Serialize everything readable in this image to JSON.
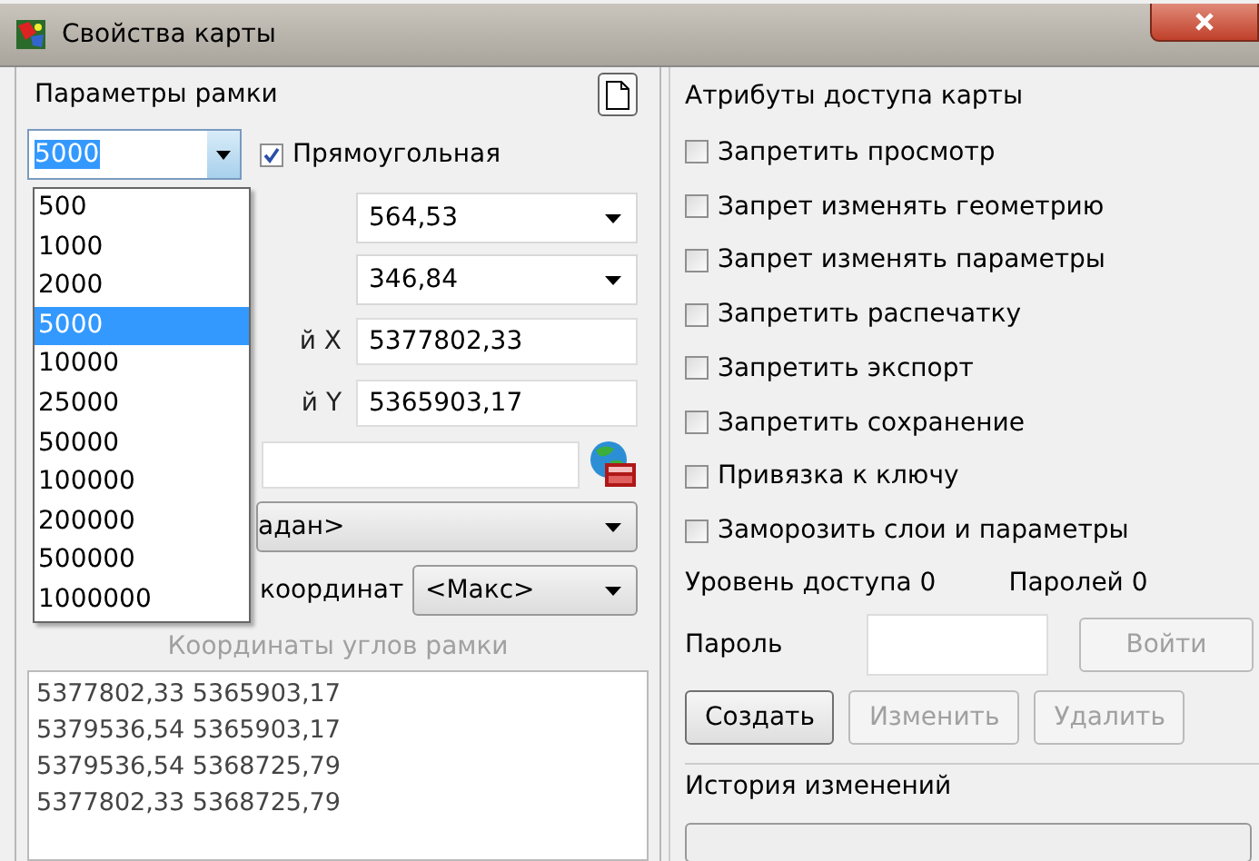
{
  "window": {
    "title": "Свойства карты"
  },
  "frame": {
    "title": "Параметры рамки",
    "scale": {
      "value": "5000",
      "open": true,
      "options": [
        {
          "label": "500",
          "selected": false
        },
        {
          "label": "1000",
          "selected": false
        },
        {
          "label": "2000",
          "selected": false
        },
        {
          "label": "5000",
          "selected": true
        },
        {
          "label": "10000",
          "selected": false
        },
        {
          "label": "25000",
          "selected": false
        },
        {
          "label": "50000",
          "selected": false
        },
        {
          "label": "100000",
          "selected": false
        },
        {
          "label": "200000",
          "selected": false
        },
        {
          "label": "500000",
          "selected": false
        },
        {
          "label": "1000000",
          "selected": false
        }
      ]
    },
    "rectangular": {
      "label": "Прямоугольная",
      "checked": true
    },
    "rows": [
      {
        "kind": "combo",
        "value": "564,53"
      },
      {
        "kind": "combo",
        "value": "346,84"
      },
      {
        "kind": "text",
        "label": "й X",
        "value": "5377802,33"
      },
      {
        "kind": "text",
        "label": "й Y",
        "value": "5365903,17"
      },
      {
        "kind": "picker"
      },
      {
        "kind": "wide-combo",
        "value": "адан>"
      }
    ],
    "precision": {
      "label": "координат",
      "value": "<Макс>"
    },
    "corners_title": "Координаты углов рамки",
    "corners": [
      "5377802,33 5365903,17",
      "5379536,54 5365903,17",
      "5379536,54 5368725,79",
      "5377802,33 5368725,79"
    ]
  },
  "access": {
    "title": "Атрибуты доступа карты",
    "options": [
      {
        "label": "Запретить просмотр",
        "checked": false
      },
      {
        "label": "Запрет изменять геометрию",
        "checked": false
      },
      {
        "label": "Запрет изменять параметры",
        "checked": false
      },
      {
        "label": "Запретить распечатку",
        "checked": false
      },
      {
        "label": "Запретить экспорт",
        "checked": false
      },
      {
        "label": "Запретить сохранение",
        "checked": false
      },
      {
        "label": "Привязка к ключу",
        "checked": false
      },
      {
        "label": "Заморозить слои и параметры",
        "checked": false
      }
    ],
    "level": "Уровень доступа 0",
    "passwords": "Паролей 0",
    "password_label": "Пароль",
    "login": {
      "label": "Войти",
      "disabled": true
    },
    "buttons": [
      {
        "label": "Создать",
        "disabled": false
      },
      {
        "label": "Изменить",
        "disabled": true
      },
      {
        "label": "Удалить",
        "disabled": true
      }
    ]
  },
  "history": {
    "title": "История изменений"
  }
}
